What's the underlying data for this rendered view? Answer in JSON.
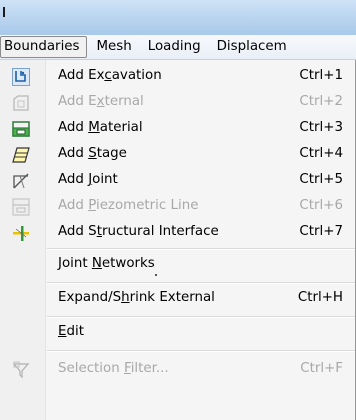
{
  "menubar": {
    "items": [
      "Boundaries",
      "Mesh",
      "Loading",
      "Displacem"
    ],
    "active_index": 0
  },
  "menu": {
    "items": [
      {
        "label": "Add Excavation",
        "mnemonic": "c",
        "accel": "Ctrl+1",
        "enabled": true,
        "icon": "excavation-icon"
      },
      {
        "label": "Add External",
        "mnemonic": "x",
        "accel": "Ctrl+2",
        "enabled": false,
        "icon": "external-boundary-icon"
      },
      {
        "label": "Add Material",
        "mnemonic": "M",
        "accel": "Ctrl+3",
        "enabled": true,
        "icon": "material-boundary-icon"
      },
      {
        "label": "Add Stage",
        "mnemonic": "S",
        "accel": "Ctrl+4",
        "enabled": true,
        "icon": "stage-boundary-icon"
      },
      {
        "label": "Add Joint",
        "mnemonic": "J",
        "accel": "Ctrl+5",
        "enabled": true,
        "icon": "joint-boundary-icon"
      },
      {
        "label": "Add Piezometric Line",
        "mnemonic": "P",
        "accel": "Ctrl+6",
        "enabled": false,
        "icon": "piezometric-line-icon"
      },
      {
        "label": "Add Structural Interface",
        "mnemonic": "t",
        "accel": "Ctrl+7",
        "enabled": true,
        "icon": "structural-interface-icon"
      },
      {
        "label": "Joint Networks",
        "mnemonic": "N",
        "accel": "",
        "enabled": true,
        "icon": ""
      },
      {
        "label": "Expand/Shrink External",
        "mnemonic": "h",
        "accel": "Ctrl+H",
        "enabled": true,
        "icon": ""
      },
      {
        "label": "Edit",
        "mnemonic": "E",
        "accel": "",
        "enabled": true,
        "icon": ""
      },
      {
        "label": "Selection Filter...",
        "mnemonic": "F",
        "accel": "Ctrl+F",
        "enabled": false,
        "icon": "selection-filter-icon"
      }
    ]
  },
  "colors": {
    "titlebar": "#bcd6f0",
    "menubar": "#eef3f9",
    "menu_bg": "#f5f5f5",
    "disabled_text": "#a8a8a8",
    "icon_blue": "#1f5fa8",
    "icon_green": "#2e9b3a",
    "icon_yellow": "#e8c400"
  }
}
